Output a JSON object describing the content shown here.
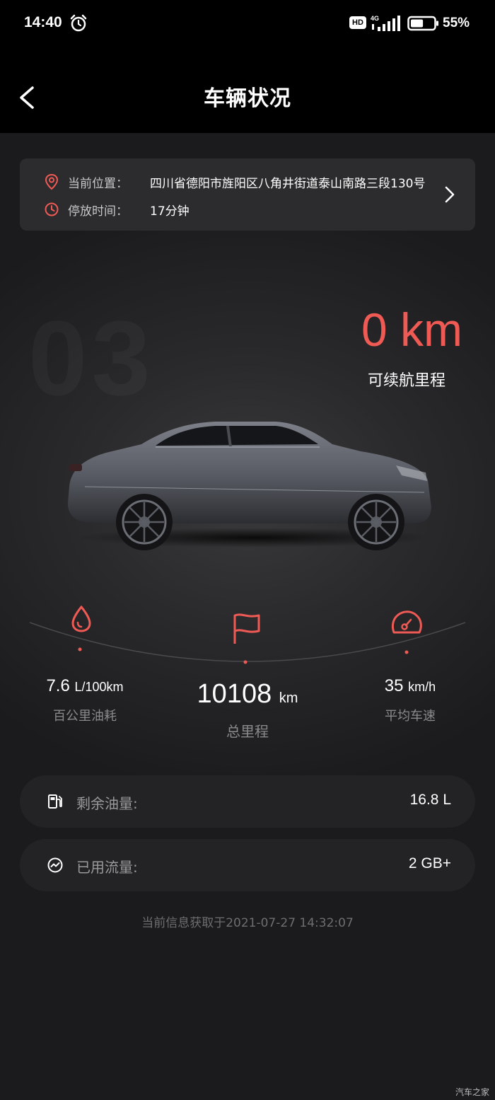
{
  "status_bar": {
    "time": "14:40",
    "network_badge": "HD",
    "network_type": "4G",
    "battery_percent": "55%",
    "battery_level": 0.55
  },
  "header": {
    "title": "车辆状况",
    "back_icon": "chevron-left-icon"
  },
  "location": {
    "position_label": "当前位置：",
    "position_value": "四川省德阳市旌阳区八角井街道泰山南路三段130号",
    "parked_label": "停放时间：",
    "parked_value": "17分钟"
  },
  "hero": {
    "watermark": "03",
    "range_value": "0 km",
    "range_label": "可续航里程"
  },
  "stats": {
    "fuel": {
      "value": "7.6",
      "unit": "L/100km",
      "label": "百公里油耗",
      "icon": "fuel-drop-icon"
    },
    "mileage": {
      "value": "10108",
      "unit": "km",
      "label": "总里程",
      "icon": "flag-icon"
    },
    "speed": {
      "value": "35",
      "unit": "km/h",
      "label": "平均车速",
      "icon": "speedometer-icon"
    }
  },
  "info": {
    "fuel_left_label": "剩余油量:",
    "fuel_left_value": "16.8 L",
    "data_used_label": "已用流量:",
    "data_used_value": "2 GB+"
  },
  "footer": {
    "updated": "当前信息获取于2021-07-27 14:32:07"
  },
  "watermark_brand": "汽车之家",
  "colors": {
    "accent": "#ef5a54",
    "background": "#1e1e20",
    "card": "#2c2c2f"
  }
}
